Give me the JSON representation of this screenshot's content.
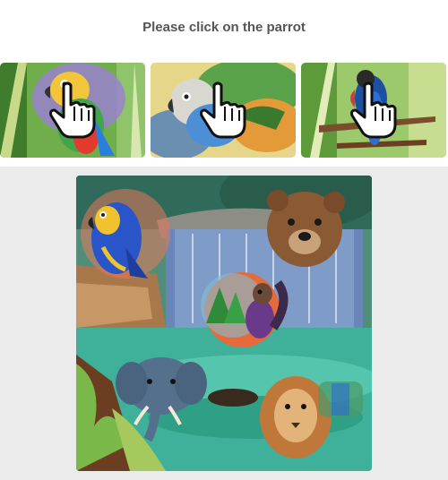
{
  "prompt": "Please click on the parrot",
  "examples": [
    {
      "subject": "parrot",
      "icon": "hand-cursor-icon"
    },
    {
      "subject": "parrot",
      "icon": "hand-cursor-icon"
    },
    {
      "subject": "parrot",
      "icon": "hand-cursor-icon"
    }
  ],
  "scene": {
    "subjects": [
      "parrot",
      "bear",
      "squirrel",
      "elephant",
      "lion"
    ]
  }
}
